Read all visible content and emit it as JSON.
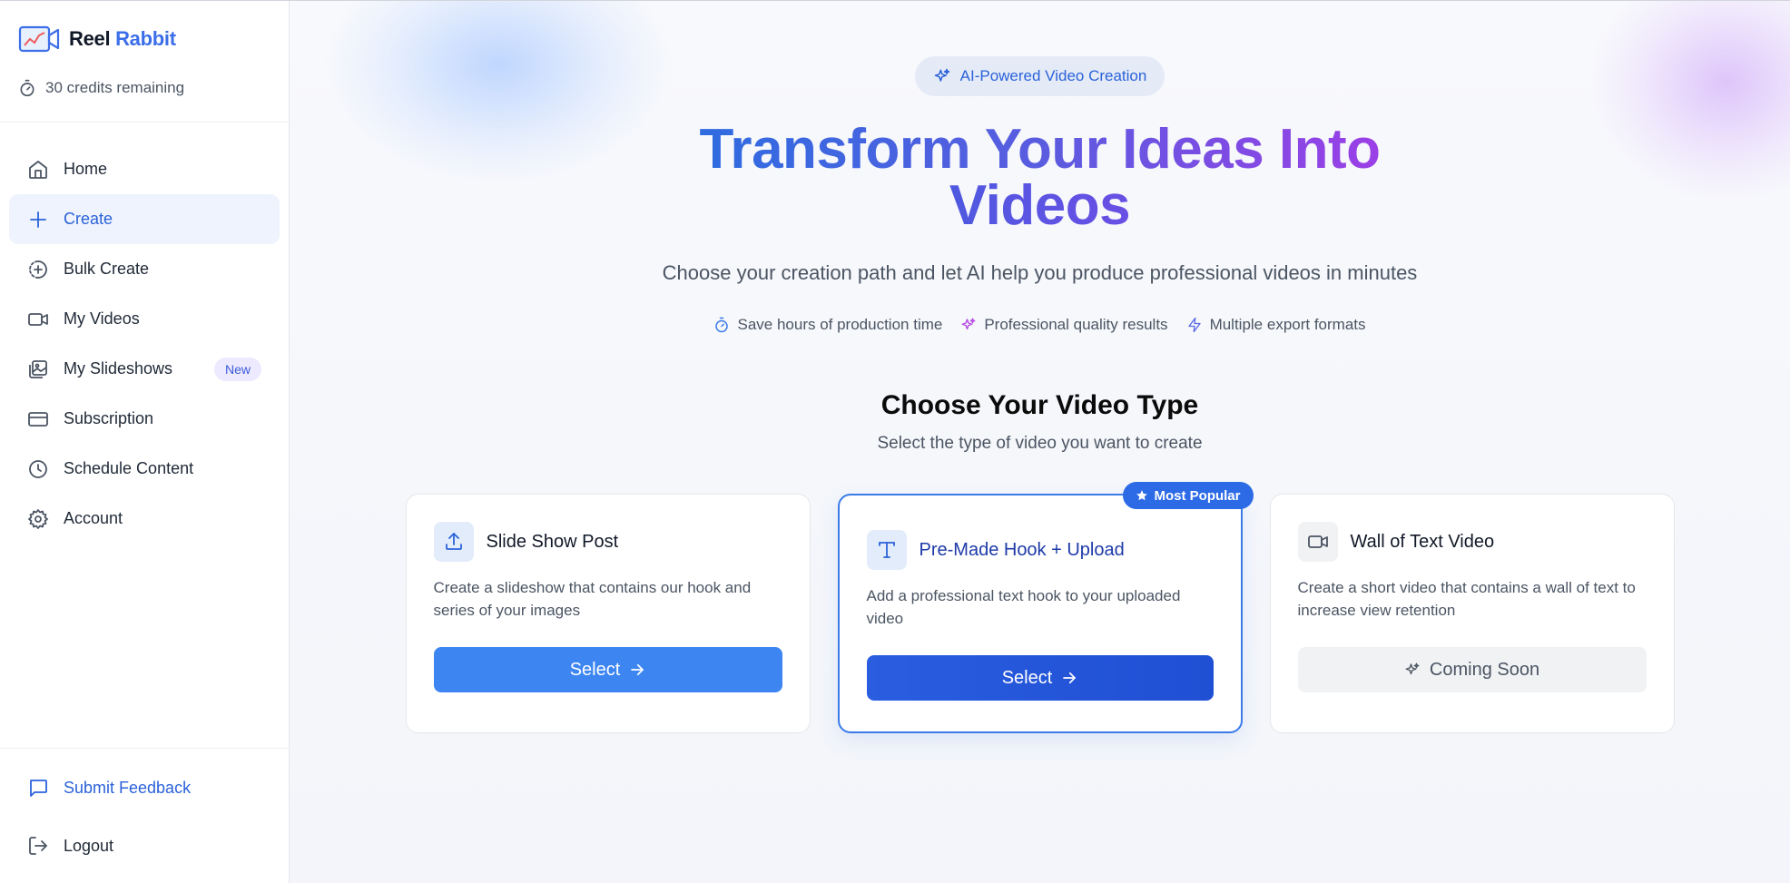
{
  "brand": {
    "name_part1": "Reel",
    "name_part2": "Rabbit"
  },
  "credits": {
    "text": "30 credits remaining"
  },
  "nav": {
    "items": [
      {
        "label": "Home",
        "icon": "home-icon"
      },
      {
        "label": "Create",
        "icon": "plus-icon",
        "active": true
      },
      {
        "label": "Bulk Create",
        "icon": "bulk-create-icon"
      },
      {
        "label": "My Videos",
        "icon": "video-icon"
      },
      {
        "label": "My Slideshows",
        "icon": "images-icon",
        "badge": "New"
      },
      {
        "label": "Subscription",
        "icon": "credit-card-icon"
      },
      {
        "label": "Schedule Content",
        "icon": "clock-icon"
      },
      {
        "label": "Account",
        "icon": "gear-icon"
      }
    ]
  },
  "footer": {
    "feedback": "Submit Feedback",
    "logout": "Logout"
  },
  "hero": {
    "pill": "AI-Powered Video Creation",
    "title_line1": "Transform Your Ideas Into",
    "title_line2": "Videos",
    "subtitle": "Choose your creation path and let AI help you produce professional videos in minutes",
    "features": [
      "Save hours of production time",
      "Professional quality results",
      "Multiple export formats"
    ]
  },
  "section": {
    "title": "Choose Your Video Type",
    "subtitle": "Select the type of video you want to create"
  },
  "cards": [
    {
      "title": "Slide Show Post",
      "desc": "Create a slideshow that contains our hook and series of your images",
      "button": "Select",
      "icon": "upload-icon"
    },
    {
      "title": "Pre-Made Hook + Upload",
      "desc": "Add a professional text hook to your uploaded video",
      "button": "Select",
      "badge": "Most Popular",
      "icon": "text-t-icon"
    },
    {
      "title": "Wall of Text Video",
      "desc": "Create a short video that contains a wall of text to increase view retention",
      "button": "Coming Soon",
      "icon": "video-icon"
    }
  ],
  "colors": {
    "accent": "#2b62d9",
    "primary_button": "#3d86f2",
    "featured_border": "#3b7be8",
    "badge_bg": "#2d6be6"
  }
}
